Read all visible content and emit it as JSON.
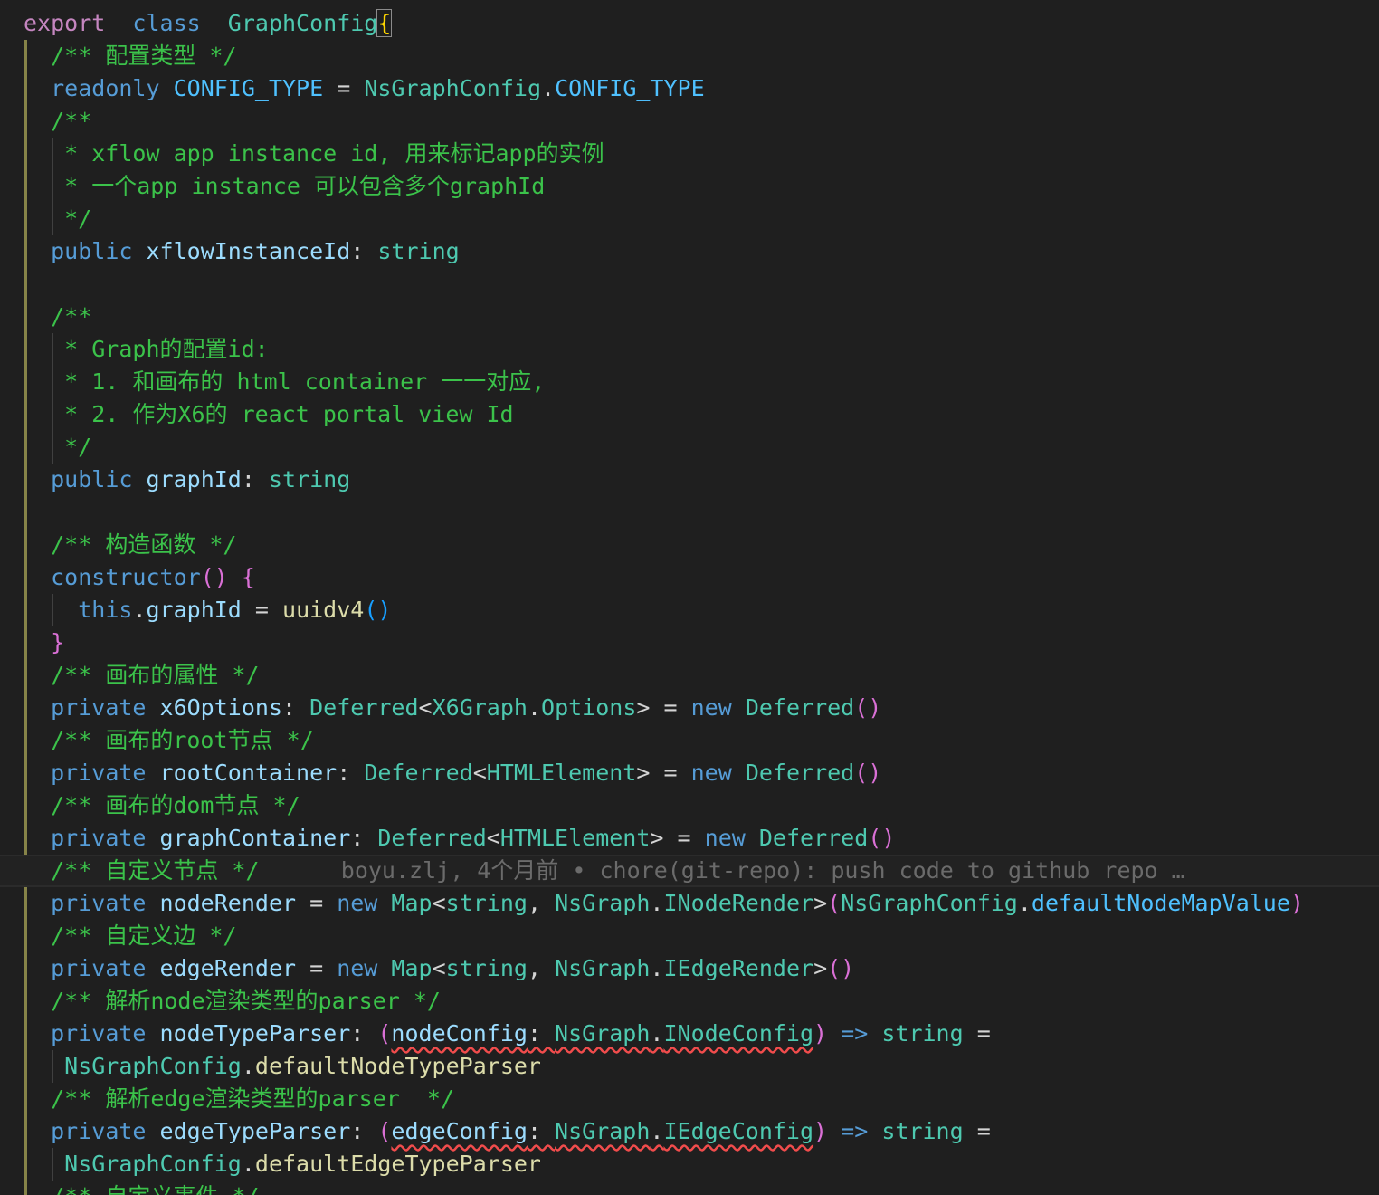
{
  "colors": {
    "background": "#1f1f1f",
    "keyword": "#569cd6",
    "keyword_control": "#c586c0",
    "type": "#4ec9b0",
    "property": "#9cdcfe",
    "constant": "#4fc1ff",
    "function": "#dcdcaa",
    "comment": "#3bc24a",
    "bracket_gold": "#ffd700",
    "bracket_pink": "#da70d6",
    "bracket_blue": "#179fff",
    "blame": "#6b6b6b",
    "error_squiggle": "#f14c4c",
    "active_indent_guide": "#868348"
  },
  "blame": "boyu.zlj, 4个月前 • chore(git-repo): push code to github repo …",
  "lines": [
    [
      [
        "kw2",
        "export"
      ],
      [
        "",
        "  "
      ],
      [
        "kw",
        "class"
      ],
      [
        "",
        "  "
      ],
      [
        "cls",
        "GraphConfig"
      ],
      [
        "",
        ""
      ],
      [
        "br1 bracket-box",
        "{"
      ]
    ],
    [
      [
        "",
        "  "
      ],
      [
        "cm",
        "/** 配置类型 */"
      ]
    ],
    [
      [
        "",
        "  "
      ],
      [
        "kw",
        "readonly"
      ],
      [
        "",
        " "
      ],
      [
        "const",
        "CONFIG_TYPE"
      ],
      [
        "op",
        " = "
      ],
      [
        "cls",
        "NsGraphConfig"
      ],
      [
        "pn",
        "."
      ],
      [
        "const",
        "CONFIG_TYPE"
      ]
    ],
    [
      [
        "",
        "  "
      ],
      [
        "cm",
        "/**"
      ]
    ],
    [
      [
        "",
        "   "
      ],
      [
        "cm",
        "* xflow app instance id, 用来标记app的实例"
      ]
    ],
    [
      [
        "",
        "   "
      ],
      [
        "cm",
        "* 一个app instance 可以包含多个graphId"
      ]
    ],
    [
      [
        "",
        "   "
      ],
      [
        "cm",
        "*/"
      ]
    ],
    [
      [
        "",
        "  "
      ],
      [
        "kw",
        "public"
      ],
      [
        "",
        " "
      ],
      [
        "prop",
        "xflowInstanceId"
      ],
      [
        "op",
        ": "
      ],
      [
        "ty",
        "string"
      ]
    ],
    [],
    [
      [
        "",
        "  "
      ],
      [
        "cm",
        "/**"
      ]
    ],
    [
      [
        "",
        "   "
      ],
      [
        "cm",
        "* Graph的配置id:"
      ]
    ],
    [
      [
        "",
        "   "
      ],
      [
        "cm",
        "* 1. 和画布的 html container 一一对应,"
      ]
    ],
    [
      [
        "",
        "   "
      ],
      [
        "cm",
        "* 2. 作为X6的 react portal view Id"
      ]
    ],
    [
      [
        "",
        "   "
      ],
      [
        "cm",
        "*/"
      ]
    ],
    [
      [
        "",
        "  "
      ],
      [
        "kw",
        "public"
      ],
      [
        "",
        " "
      ],
      [
        "prop",
        "graphId"
      ],
      [
        "op",
        ": "
      ],
      [
        "ty",
        "string"
      ]
    ],
    [],
    [
      [
        "",
        "  "
      ],
      [
        "cm",
        "/** 构造函数 */"
      ]
    ],
    [
      [
        "",
        "  "
      ],
      [
        "kw",
        "constructor"
      ],
      [
        "br2",
        "()"
      ],
      [
        "",
        " "
      ],
      [
        "br2",
        "{"
      ]
    ],
    [
      [
        "",
        "    "
      ],
      [
        "this",
        "this"
      ],
      [
        "pn",
        "."
      ],
      [
        "prop",
        "graphId"
      ],
      [
        "op",
        " = "
      ],
      [
        "fn",
        "uuidv4"
      ],
      [
        "br3",
        "()"
      ]
    ],
    [
      [
        "",
        "  "
      ],
      [
        "br2",
        "}"
      ]
    ],
    [
      [
        "",
        "  "
      ],
      [
        "cm",
        "/** 画布的属性 */"
      ]
    ],
    [
      [
        "",
        "  "
      ],
      [
        "kw",
        "private"
      ],
      [
        "",
        " "
      ],
      [
        "prop",
        "x6Options"
      ],
      [
        "op",
        ": "
      ],
      [
        "cls",
        "Deferred"
      ],
      [
        "op",
        "<"
      ],
      [
        "cls",
        "X6Graph"
      ],
      [
        "pn",
        "."
      ],
      [
        "cls",
        "Options"
      ],
      [
        "op",
        "> = "
      ],
      [
        "kw",
        "new"
      ],
      [
        "",
        " "
      ],
      [
        "cls",
        "Deferred"
      ],
      [
        "br2",
        "()"
      ]
    ],
    [
      [
        "",
        "  "
      ],
      [
        "cm",
        "/** 画布的root节点 */"
      ]
    ],
    [
      [
        "",
        "  "
      ],
      [
        "kw",
        "private"
      ],
      [
        "",
        " "
      ],
      [
        "prop",
        "rootContainer"
      ],
      [
        "op",
        ": "
      ],
      [
        "cls",
        "Deferred"
      ],
      [
        "op",
        "<"
      ],
      [
        "cls",
        "HTMLElement"
      ],
      [
        "op",
        "> = "
      ],
      [
        "kw",
        "new"
      ],
      [
        "",
        " "
      ],
      [
        "cls",
        "Deferred"
      ],
      [
        "br2",
        "()"
      ]
    ],
    [
      [
        "",
        "  "
      ],
      [
        "cm",
        "/** 画布的dom节点 */"
      ]
    ],
    [
      [
        "",
        "  "
      ],
      [
        "kw",
        "private"
      ],
      [
        "",
        " "
      ],
      [
        "prop",
        "graphContainer"
      ],
      [
        "op",
        ": "
      ],
      [
        "cls",
        "Deferred"
      ],
      [
        "op",
        "<"
      ],
      [
        "cls",
        "HTMLElement"
      ],
      [
        "op",
        "> = "
      ],
      [
        "kw",
        "new"
      ],
      [
        "",
        " "
      ],
      [
        "cls",
        "Deferred"
      ],
      [
        "br2",
        "()"
      ]
    ],
    [
      [
        "",
        "  "
      ],
      [
        "cm",
        "/** 自定义节点 */"
      ],
      [
        "",
        "      "
      ],
      [
        "blame",
        "@blame"
      ]
    ],
    [
      [
        "",
        "  "
      ],
      [
        "kw",
        "private"
      ],
      [
        "",
        " "
      ],
      [
        "prop",
        "nodeRender"
      ],
      [
        "op",
        " = "
      ],
      [
        "kw",
        "new"
      ],
      [
        "",
        " "
      ],
      [
        "cls",
        "Map"
      ],
      [
        "op",
        "<"
      ],
      [
        "ty",
        "string"
      ],
      [
        "op",
        ", "
      ],
      [
        "cls",
        "NsGraph"
      ],
      [
        "pn",
        "."
      ],
      [
        "cls",
        "INodeRender"
      ],
      [
        "op",
        ">"
      ],
      [
        "br2",
        "("
      ],
      [
        "cls",
        "NsGraphConfig"
      ],
      [
        "pn",
        "."
      ],
      [
        "const",
        "defaultNodeMapValue"
      ],
      [
        "br2",
        ")"
      ]
    ],
    [
      [
        "",
        "  "
      ],
      [
        "cm",
        "/** 自定义边 */"
      ]
    ],
    [
      [
        "",
        "  "
      ],
      [
        "kw",
        "private"
      ],
      [
        "",
        " "
      ],
      [
        "prop",
        "edgeRender"
      ],
      [
        "op",
        " = "
      ],
      [
        "kw",
        "new"
      ],
      [
        "",
        " "
      ],
      [
        "cls",
        "Map"
      ],
      [
        "op",
        "<"
      ],
      [
        "ty",
        "string"
      ],
      [
        "op",
        ", "
      ],
      [
        "cls",
        "NsGraph"
      ],
      [
        "pn",
        "."
      ],
      [
        "cls",
        "IEdgeRender"
      ],
      [
        "op",
        ">"
      ],
      [
        "br2",
        "()"
      ]
    ],
    [
      [
        "",
        "  "
      ],
      [
        "cm",
        "/** 解析node渲染类型的parser */"
      ]
    ],
    [
      [
        "",
        "  "
      ],
      [
        "kw",
        "private"
      ],
      [
        "",
        " "
      ],
      [
        "prop",
        "nodeTypeParser"
      ],
      [
        "op",
        ": "
      ],
      [
        "br2",
        "("
      ],
      [
        "prop squig",
        "nodeConfig"
      ],
      [
        "op squig",
        ": "
      ],
      [
        "cls squig",
        "NsGraph"
      ],
      [
        "pn squig",
        "."
      ],
      [
        "cls squig",
        "INodeConfig"
      ],
      [
        "br2",
        ")"
      ],
      [
        "",
        " "
      ],
      [
        "kw",
        "=>"
      ],
      [
        "",
        " "
      ],
      [
        "ty",
        "string"
      ],
      [
        "op",
        " ="
      ]
    ],
    [
      [
        "",
        "   "
      ],
      [
        "cls",
        "NsGraphConfig"
      ],
      [
        "pn",
        "."
      ],
      [
        "fn",
        "defaultNodeTypeParser"
      ]
    ],
    [
      [
        "",
        "  "
      ],
      [
        "cm",
        "/** 解析edge渲染类型的parser  */"
      ]
    ],
    [
      [
        "",
        "  "
      ],
      [
        "kw",
        "private"
      ],
      [
        "",
        " "
      ],
      [
        "prop",
        "edgeTypeParser"
      ],
      [
        "op",
        ": "
      ],
      [
        "br2",
        "("
      ],
      [
        "prop squig",
        "edgeConfig"
      ],
      [
        "op squig",
        ": "
      ],
      [
        "cls squig",
        "NsGraph"
      ],
      [
        "pn squig",
        "."
      ],
      [
        "cls squig",
        "IEdgeConfig"
      ],
      [
        "br2",
        ")"
      ],
      [
        "",
        " "
      ],
      [
        "kw",
        "=>"
      ],
      [
        "",
        " "
      ],
      [
        "ty",
        "string"
      ],
      [
        "op",
        " ="
      ]
    ],
    [
      [
        "",
        "   "
      ],
      [
        "cls",
        "NsGraphConfig"
      ],
      [
        "pn",
        "."
      ],
      [
        "fn",
        "defaultEdgeTypeParser"
      ]
    ],
    [
      [
        "",
        "  "
      ],
      [
        "cm",
        "/** 自定义事件 */"
      ]
    ]
  ]
}
